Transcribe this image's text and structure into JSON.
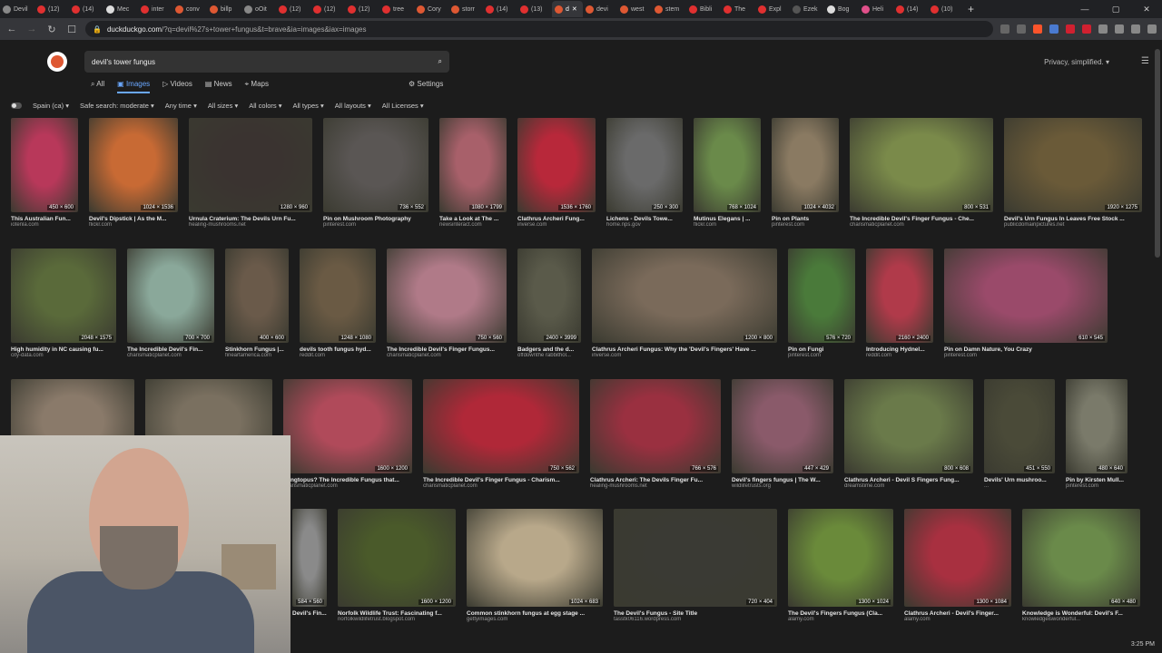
{
  "tabs": [
    {
      "label": "Devil",
      "fav": "#888"
    },
    {
      "label": "(12)",
      "fav": "#e03030"
    },
    {
      "label": "(14)",
      "fav": "#e03030"
    },
    {
      "label": "Mec",
      "fav": "#ddd"
    },
    {
      "label": "inter",
      "fav": "#e03030"
    },
    {
      "label": "conv",
      "fav": "#de5833"
    },
    {
      "label": "billp",
      "fav": "#de5833"
    },
    {
      "label": "oOit",
      "fav": "#888"
    },
    {
      "label": "(12)",
      "fav": "#e03030"
    },
    {
      "label": "(12)",
      "fav": "#e03030"
    },
    {
      "label": "(12)",
      "fav": "#e03030"
    },
    {
      "label": "tree",
      "fav": "#e03030"
    },
    {
      "label": "Cory",
      "fav": "#de5833"
    },
    {
      "label": "storr",
      "fav": "#de5833"
    },
    {
      "label": "(14)",
      "fav": "#e03030"
    },
    {
      "label": "(13)",
      "fav": "#e03030"
    },
    {
      "label": "d",
      "fav": "#de5833",
      "active": true
    },
    {
      "label": "devi",
      "fav": "#de5833"
    },
    {
      "label": "west",
      "fav": "#de5833"
    },
    {
      "label": "stem",
      "fav": "#de5833"
    },
    {
      "label": "Bibli",
      "fav": "#e03030"
    },
    {
      "label": "The",
      "fav": "#e03030"
    },
    {
      "label": "Expl",
      "fav": "#e03030"
    },
    {
      "label": "Ezek",
      "fav": "#555"
    },
    {
      "label": "Bog",
      "fav": "#ddd"
    },
    {
      "label": "Heli",
      "fav": "#e0508a"
    },
    {
      "label": "(14)",
      "fav": "#e03030"
    },
    {
      "label": "(10)",
      "fav": "#e03030"
    }
  ],
  "address": {
    "host": "duckduckgo.com",
    "path": "/?q=devil%27s+tower+fungus&t=brave&ia=images&iax=images"
  },
  "search": {
    "query": "devil's tower fungus"
  },
  "privacy_label": "Privacy, simplified.",
  "nav_tabs": [
    {
      "label": "All",
      "icon": "search-icon"
    },
    {
      "label": "Images",
      "icon": "image-icon",
      "active": true
    },
    {
      "label": "Videos",
      "icon": "play-icon"
    },
    {
      "label": "News",
      "icon": "news-icon"
    },
    {
      "label": "Maps",
      "icon": "pin-icon"
    }
  ],
  "settings_label": "Settings",
  "filters": [
    "Spain (ca)",
    "Safe search: moderate",
    "Any time",
    "All sizes",
    "All colors",
    "All types",
    "All layouts",
    "All Licenses"
  ],
  "images": [
    {
      "caption": "This Australian Fun...",
      "source": "iotenla.com",
      "dims": "450 × 600",
      "color": "#b8385a"
    },
    {
      "caption": "Devil's Dipstick | As the M...",
      "source": "flickr.com",
      "dims": "1024 × 1536",
      "color": "#c86a34"
    },
    {
      "caption": "Urnula Craterium: The Devils Urn Fu...",
      "source": "healing-mushrooms.net",
      "dims": "1280 × 960",
      "color": "#3a3330"
    },
    {
      "caption": "Pin on Mushroom Photography",
      "source": "pinterest.com",
      "dims": "736 × 552",
      "color": "#5a5654"
    },
    {
      "caption": "Take a Look at The ...",
      "source": "newsinteract.com",
      "dims": "1080 × 1799",
      "color": "#a8606a"
    },
    {
      "caption": "Clathrus Archeri Fung...",
      "source": "inverse.com",
      "dims": "1536 × 1760",
      "color": "#b8283a"
    },
    {
      "caption": "Lichens - Devils Towe...",
      "source": "home.nps.gov",
      "dims": "250 × 300",
      "color": "#6a6a6a"
    },
    {
      "caption": "Mutinus Elegans | ...",
      "source": "flickr.com",
      "dims": "768 × 1024",
      "color": "#6a8a4a"
    },
    {
      "caption": "Pin on Plants",
      "source": "pinterest.com",
      "dims": "1024 × 4032",
      "color": "#8a7a62"
    },
    {
      "caption": "The Incredible Devil's Finger Fungus - Che...",
      "source": "charismaticplanet.com",
      "dims": "800 × 531",
      "color": "#7a8a4a"
    },
    {
      "caption": "Devil's Urn Fungus In Leaves Free Stock ...",
      "source": "publicdomainpictures.net",
      "dims": "1920 × 1275",
      "color": "#6a5a38"
    },
    {
      "caption": "High humidity in NC causing fu...",
      "source": "city-data.com",
      "dims": "2048 × 1575",
      "color": "#5a6a3a"
    },
    {
      "caption": "The Incredible Devil's Fin...",
      "source": "charismaticplanet.com",
      "dims": "700 × 700",
      "color": "#8aa89a"
    },
    {
      "caption": "Stinkhorn Fungus |...",
      "source": "fineartamerica.com",
      "dims": "400 × 600",
      "color": "#6a5a4a"
    },
    {
      "caption": "devils tooth fungus hyd...",
      "source": "reddit.com",
      "dims": "1248 × 1080",
      "color": "#6a5a44"
    },
    {
      "caption": "The Incredible Devil's Finger Fungus...",
      "source": "charismaticplanet.com",
      "dims": "750 × 560",
      "color": "#b07a88"
    },
    {
      "caption": "Badgers and the d...",
      "source": "offdownthe rabbithol...",
      "dims": "2400 × 3999",
      "color": "#5a5a4a"
    },
    {
      "caption": "Clathrus Archeri Fungus: Why the 'Devil's Fingers' Have ...",
      "source": "inverse.com",
      "dims": "1200 × 800",
      "color": "#7a6a5a"
    },
    {
      "caption": "Pin on Fungi",
      "source": "pinterest.com",
      "dims": "576 × 720",
      "color": "#4a7a3a"
    },
    {
      "caption": "Introducing Hydnel...",
      "source": "reddit.com",
      "dims": "2160 × 2400",
      "color": "#b03a4a"
    },
    {
      "caption": "Pin on Damn Nature, You Crazy",
      "source": "pinterest.com",
      "dims": "610 × 545",
      "color": "#9a4a6a"
    },
    {
      "caption": "",
      "source": "",
      "dims": "",
      "color": "#8a7a6a"
    },
    {
      "caption": "",
      "source": "",
      "dims": "",
      "color": "#7a7060"
    },
    {
      "caption": "Fungtopus? The Incredible Fungus that...",
      "source": "charismaticplanet.com",
      "dims": "1600 × 1200",
      "color": "#b04a5a"
    },
    {
      "caption": "The Incredible Devil's Finger Fungus - Charism...",
      "source": "charismaticplanet.com",
      "dims": "750 × 562",
      "color": "#b02838"
    },
    {
      "caption": "Clathrus Archeri: The Devils Finger Fu...",
      "source": "healing-mushrooms.net",
      "dims": "766 × 576",
      "color": "#9a3040"
    },
    {
      "caption": "Devil's fingers fungus | The W...",
      "source": "wildlifetrusts.org",
      "dims": "447 × 429",
      "color": "#8a5a6a"
    },
    {
      "caption": "Clathrus Archeri - Devil S Fingers Fung...",
      "source": "dreamstime.com",
      "dims": "800 × 608",
      "color": "#6a7a4a"
    },
    {
      "caption": "Devils' Urn mushroo...",
      "source": "...",
      "dims": "451 × 550",
      "color": "#4a4a38"
    },
    {
      "caption": "Pin by Kirsten Mull...",
      "source": "pinterest.com",
      "dims": "480 × 640",
      "color": "#7a7a6a"
    },
    {
      "caption": "Devil's Fin...",
      "source": "",
      "dims": "584 × 560",
      "color": "#8a8a8a"
    },
    {
      "caption": "Norfolk Wildlife Trust: Fascinating f...",
      "source": "norfolkwildlifetrust.blogspot.com",
      "dims": "1600 × 1200",
      "color": "#4a5a2a"
    },
    {
      "caption": "Common stinkhorn fungus at egg stage ...",
      "source": "gettyimages.com",
      "dims": "1024 × 683",
      "color": "#b8a88a"
    },
    {
      "caption": "The Devil's Fungus - Site Title",
      "source": "tasstk06116.wordpress.com",
      "dims": "720 × 404",
      "color": "#3a3a34"
    },
    {
      "caption": "The Devil's Fingers Fungus (Cla...",
      "source": "alamy.com",
      "dims": "1300 × 1024",
      "color": "#6a8a3a"
    },
    {
      "caption": "Clathrus Archeri - Devil's Finger...",
      "source": "alamy.com",
      "dims": "1300 × 1084",
      "color": "#a83040"
    },
    {
      "caption": "Knowledge is Wonderful: Devil's F...",
      "source": "knowledgeiswonderful...",
      "dims": "640 × 480",
      "color": "#6a8a4a"
    }
  ],
  "clock": "3:25 PM"
}
